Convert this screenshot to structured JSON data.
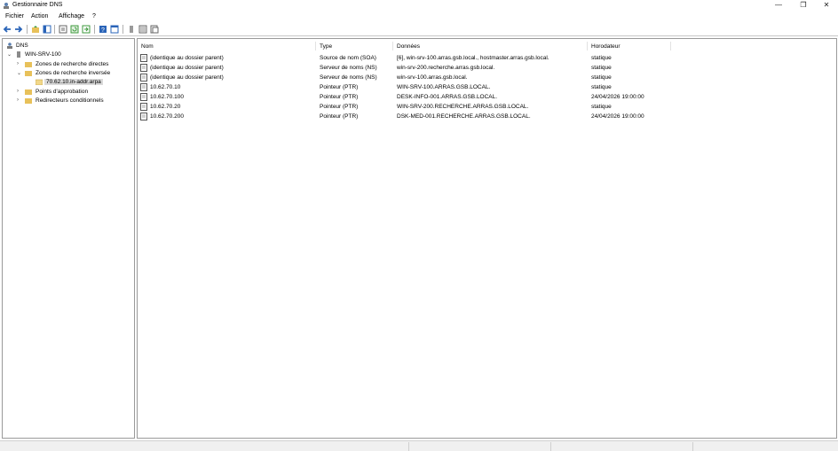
{
  "window": {
    "title": "Gestionnaire DNS",
    "controls": {
      "minimize": "—",
      "restore": "❐",
      "close": "✕"
    }
  },
  "menu": {
    "items": [
      "Fichier",
      "Action",
      "Affichage",
      "?"
    ]
  },
  "toolbar": {
    "buttons": [
      "back-icon",
      "forward-icon",
      "folder-up-icon",
      "show-hide-tree-icon",
      "properties-icon",
      "refresh-icon",
      "export-list-icon",
      "help-icon",
      "console-tree-icon",
      "server-icon",
      "record-list-icon",
      "record-properties-icon"
    ]
  },
  "tree": {
    "root": "DNS",
    "server": "WIN-SRV-100",
    "forward_zones": "Zones de recherche directes",
    "reverse_zones": "Zones de recherche inversée",
    "reverse_zone_item": "70.62.10.in-addr.arpa",
    "trust_points": "Points d'approbation",
    "conditional_forwarders": "Redirecteurs conditionnels",
    "expander_collapsed": "›",
    "expander_expanded": "⌄"
  },
  "list": {
    "columns": [
      "Nom",
      "Type",
      "Données",
      "Horodateur"
    ],
    "rows": [
      {
        "name": "(identique au dossier parent)",
        "type": "Source de nom (SOA)",
        "data": "[6], win-srv-100.arras.gsb.local., hostmaster.arras.gsb.local.",
        "timestamp": "statique"
      },
      {
        "name": "(identique au dossier parent)",
        "type": "Serveur de noms (NS)",
        "data": "win-srv-200.recherche.arras.gsb.local.",
        "timestamp": "statique"
      },
      {
        "name": "(identique au dossier parent)",
        "type": "Serveur de noms (NS)",
        "data": "win-srv-100.arras.gsb.local.",
        "timestamp": "statique"
      },
      {
        "name": "10.62.70.10",
        "type": "Pointeur (PTR)",
        "data": "WIN-SRV-100.ARRAS.GSB.LOCAL.",
        "timestamp": "statique"
      },
      {
        "name": "10.62.70.100",
        "type": "Pointeur (PTR)",
        "data": "DESK-INFO-001.ARRAS.GSB.LOCAL.",
        "timestamp": "24/04/2026 19:00:00"
      },
      {
        "name": "10.62.70.20",
        "type": "Pointeur (PTR)",
        "data": "WIN-SRV-200.RECHERCHE.ARRAS.GSB.LOCAL.",
        "timestamp": "statique"
      },
      {
        "name": "10.62.70.200",
        "type": "Pointeur (PTR)",
        "data": "DSK-MED-001.RECHERCHE.ARRAS.GSB.LOCAL.",
        "timestamp": "24/04/2026 19:00:00"
      }
    ]
  },
  "colors": {
    "folder": "#e8c15a",
    "pane_border": "#9a9a9a",
    "selection": "#d9d9d9",
    "toolbar_blue": "#2a64b8",
    "toolbar_green": "#3c9a3c"
  }
}
